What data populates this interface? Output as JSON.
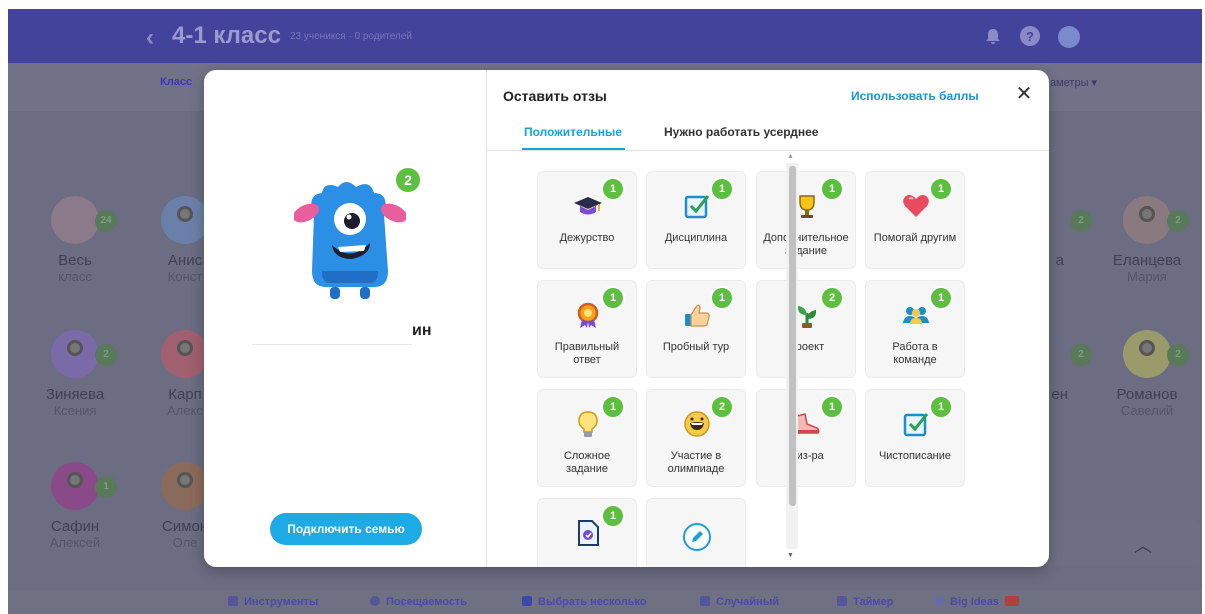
{
  "app": {
    "class_title": "4-1 класс",
    "class_meta": "23 ученикся · 0 родителей",
    "bg_tabs": [
      "Класс",
      "аметры ▾"
    ]
  },
  "students": [
    {
      "name": "Весь",
      "sub": "класс",
      "color": "#8a7a8a"
    },
    {
      "name": "Анис",
      "sub": "Конст",
      "color": "#6b80a8"
    },
    {
      "name": "Зиняева",
      "sub": "Ксения",
      "color": "#7a6aa8"
    },
    {
      "name": "Карп",
      "sub": "Алекс",
      "color": "#a06070"
    },
    {
      "name": "Сафин",
      "sub": "Алексей",
      "color": "#8a4a8a"
    },
    {
      "name": "Симон",
      "sub": "Оле",
      "color": "#8a6a5a"
    },
    {
      "name": "Еланцева",
      "sub": "Мария",
      "color": "#8a7a80"
    },
    {
      "name": "Романов",
      "sub": "Савелий",
      "color": "#9a9a6a"
    },
    {
      "name": "а",
      "sub": "",
      "color": "#70708a"
    },
    {
      "name": "ен",
      "sub": "",
      "color": "#70708a"
    }
  ],
  "bottom_bar": {
    "items": [
      "Инструменты",
      "Посещаемость",
      "Выбрать несколько",
      "Случайный",
      "Таймер",
      "Big Ideas"
    ]
  },
  "modal": {
    "title": "Оставить отзы",
    "use_points": "Использовать баллы",
    "close_icon": "close-icon",
    "tabs": {
      "positive": "Положительные",
      "needs_work": "Нужно работать усерднее"
    },
    "student": {
      "points": "2",
      "name": "ин",
      "monster_color": "#2b8fe6"
    },
    "connect_family": "Подключить семью",
    "skills": [
      {
        "label": "Дежурство",
        "points": "1",
        "icon": "graduation-cap-icon"
      },
      {
        "label": "Дисциплина",
        "points": "1",
        "icon": "checkbox-icon"
      },
      {
        "label": "Дополнительное задание",
        "points": "1",
        "icon": "trophy-icon"
      },
      {
        "label": "Помогай другим",
        "points": "1",
        "icon": "heart-icon"
      },
      {
        "label": "Правильный ответ",
        "points": "1",
        "icon": "medal-icon"
      },
      {
        "label": "Пробный тур",
        "points": "1",
        "icon": "thumbs-up-icon"
      },
      {
        "label": "Проект",
        "points": "2",
        "icon": "plant-icon"
      },
      {
        "label": "Работа в команде",
        "points": "1",
        "icon": "team-icon"
      },
      {
        "label": "Сложное задание",
        "points": "1",
        "icon": "lightbulb-icon"
      },
      {
        "label": "Участие в олимпиаде",
        "points": "2",
        "icon": "smile-icon"
      },
      {
        "label": "Физ-ра",
        "points": "1",
        "icon": "sneaker-icon"
      },
      {
        "label": "Чистописание",
        "points": "1",
        "icon": "checkbox-icon"
      },
      {
        "label": "",
        "points": "1",
        "icon": "document-icon"
      },
      {
        "label": "",
        "points": "",
        "icon": "pencil-icon"
      }
    ]
  },
  "colors": {
    "accent": "#1aa0db",
    "badge": "#5cbf3f",
    "topbar": "#43439b"
  }
}
